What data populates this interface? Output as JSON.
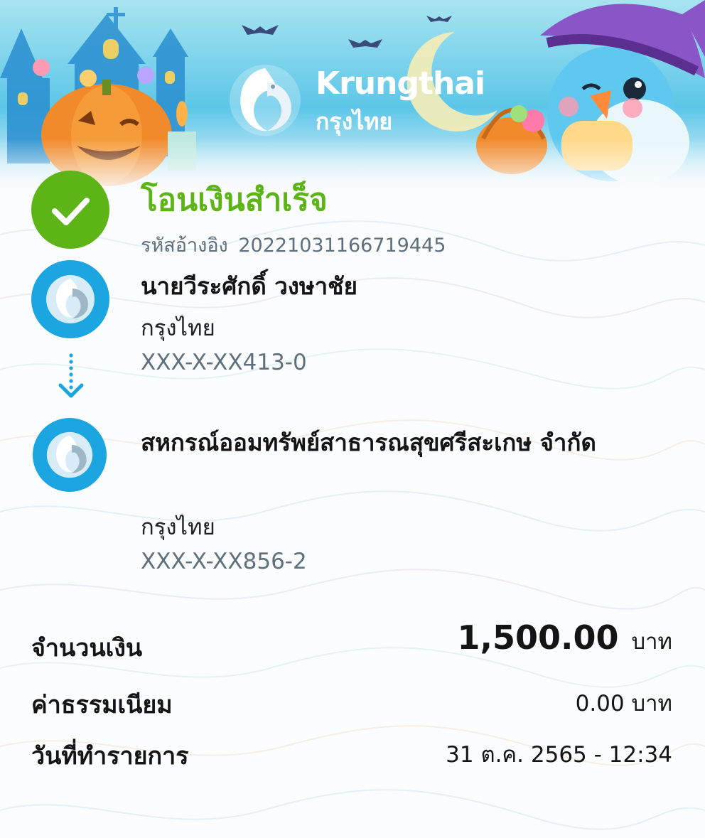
{
  "header": {
    "logo_en": "Krungthai",
    "logo_th": "กรุงไทย"
  },
  "status": {
    "title": "โอนเงินสำเร็จ",
    "reference_label": "รหัสอ้างอิง",
    "reference_number": "20221031166719445"
  },
  "sender": {
    "name": "นายวีระศักดิ์ วงษาชัย",
    "bank": "กรุงไทย",
    "account": "XXX-X-XX413-0"
  },
  "receiver": {
    "name": "สหกรณ์ออมทรัพย์สาธารณสุขศรีสะเกษ จำกัด",
    "bank": "กรุงไทย",
    "account": "XXX-X-XX856-2"
  },
  "details": {
    "amount_label": "จำนวนเงิน",
    "amount_value": "1,500.00",
    "amount_unit": "บาท",
    "fee_label": "ค่าธรรมเนียม",
    "fee_value": "0.00 บาท",
    "date_label": "วันที่ทำรายการ",
    "date_value": "31 ต.ค. 2565 - 12:34"
  },
  "colors": {
    "success_green": "#5cb416",
    "bank_blue": "#1ba5e1",
    "muted_text": "#5f6f7c"
  },
  "icons": {
    "status": "check-circle-icon",
    "bank_logo": "krungthai-bird-icon",
    "transfer_arrow": "dotted-down-arrow-icon"
  }
}
